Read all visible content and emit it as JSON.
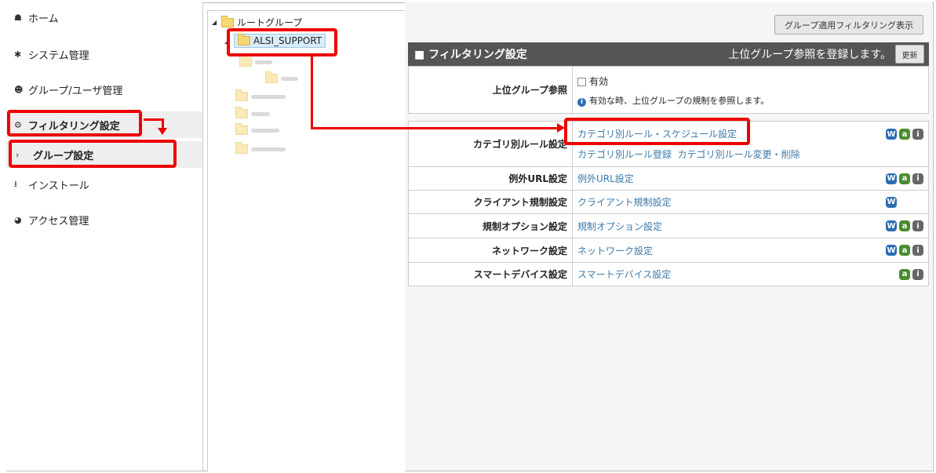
{
  "nav": {
    "items": [
      {
        "icon": "home-icon",
        "glyph": "☗",
        "label": "ホーム"
      },
      {
        "icon": "gear-icon",
        "glyph": "✱",
        "label": "システム管理"
      },
      {
        "icon": "users-icon",
        "glyph": "☻",
        "label": "グループ/ユーザ管理"
      },
      {
        "icon": "cogs-icon",
        "glyph": "⚙",
        "label": "フィルタリング設定"
      },
      {
        "icon": "chevron-right-icon",
        "glyph": "›",
        "label": "グループ設定"
      },
      {
        "icon": "download-icon",
        "glyph": "⭳",
        "label": "インストール"
      },
      {
        "icon": "pie-chart-icon",
        "glyph": "◕",
        "label": "アクセス管理"
      }
    ]
  },
  "tree": {
    "root_label": "ルートグループ",
    "selected_label": "ALSI_SUPPORT"
  },
  "header": {
    "group_filter_button": "グループ適用フィルタリング表示"
  },
  "panel": {
    "title": "■ フィルタリング設定",
    "parent_ref_text": "上位グループ参照を登録します。",
    "update_button": "更新"
  },
  "parent_ref": {
    "label": "上位グループ参照",
    "checkbox_label": "有効",
    "info_text": "有効な時、上位グループの規制を参照します。"
  },
  "settings": [
    {
      "label": "カテゴリ別ルール設定",
      "links": [
        "カテゴリ別ルール・スケジュール設定"
      ],
      "sublinks": [
        "カテゴリ別ルール登録",
        "カテゴリ別ルール変更・削除"
      ],
      "badges": [
        "W",
        "a",
        "i"
      ]
    },
    {
      "label": "例外URL設定",
      "links": [
        "例外URL設定"
      ],
      "badges": [
        "W",
        "a",
        "i"
      ]
    },
    {
      "label": "クライアント規制設定",
      "links": [
        "クライアント規制設定"
      ],
      "badges": [
        "W"
      ]
    },
    {
      "label": "規制オプション設定",
      "links": [
        "規制オプション設定"
      ],
      "badges": [
        "W",
        "a",
        "i"
      ]
    },
    {
      "label": "ネットワーク設定",
      "links": [
        "ネットワーク設定"
      ],
      "badges": [
        "W",
        "a",
        "i"
      ]
    },
    {
      "label": "スマートデバイス設定",
      "links": [
        "スマートデバイス設定"
      ],
      "badges": [
        "a",
        "i"
      ]
    }
  ],
  "colors": {
    "annotation": "#e00000",
    "panel_header": "#555555",
    "link": "#3a78a8",
    "badge_w": "#2a6fb5",
    "badge_a": "#4a8c2f",
    "badge_i": "#666666"
  }
}
